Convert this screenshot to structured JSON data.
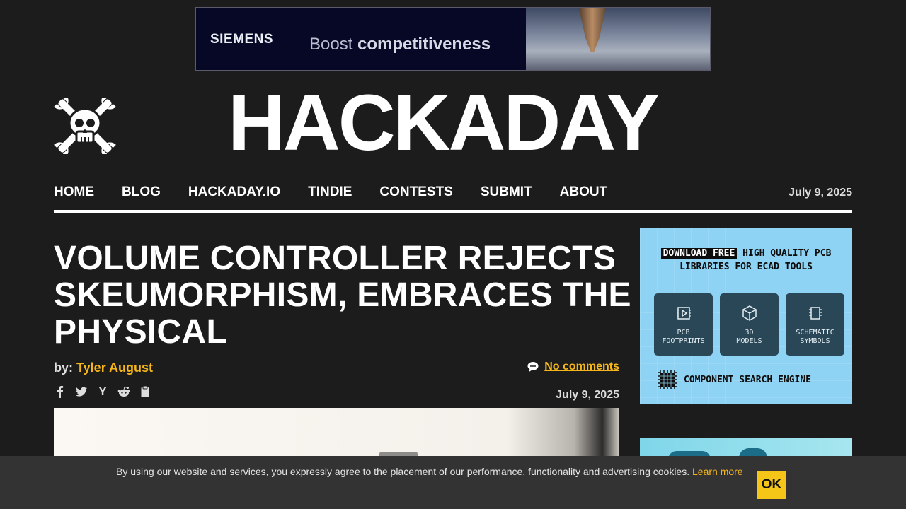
{
  "top_ad": {
    "brand": "SIEMENS",
    "tagline_prefix": "Boost",
    "tagline_emphasis": "competitiveness"
  },
  "site": {
    "title": "HACKADAY",
    "logo_icon": "skull-and-wrenches-icon"
  },
  "nav": {
    "items": [
      {
        "label": "HOME"
      },
      {
        "label": "BLOG"
      },
      {
        "label": "HACKADAY.IO"
      },
      {
        "label": "TINDIE"
      },
      {
        "label": "CONTESTS"
      },
      {
        "label": "SUBMIT"
      },
      {
        "label": "ABOUT"
      }
    ],
    "date": "July 9, 2025"
  },
  "article": {
    "title": "VOLUME CONTROLLER REJECTS SKEUMORPHISM, EMBRACES THE PHYSICAL",
    "byline_prefix": "by:",
    "author": "Tyler August",
    "comments": "No comments",
    "date": "July 9, 2025",
    "share_icons": [
      "facebook-icon",
      "twitter-icon",
      "hacker-news-icon",
      "reddit-icon",
      "clipboard-icon"
    ]
  },
  "sidebar_ad": {
    "highlight": "DOWNLOAD FREE",
    "headline_rest": "HIGH QUALITY PCB",
    "headline_line2": "LIBRARIES FOR ECAD TOOLS",
    "tiles": [
      {
        "line1": "PCB",
        "line2": "FOOTPRINTS",
        "icon": "footprint-icon"
      },
      {
        "line1": "3D",
        "line2": "MODELS",
        "icon": "cube-icon"
      },
      {
        "line1": "SCHEMATIC",
        "line2": "SYMBOLS",
        "icon": "chip-icon"
      }
    ],
    "footer": "COMPONENT SEARCH ENGINE"
  },
  "cookie": {
    "text": "By using our website and services, you expressly agree to the placement of our performance, functionality and advertising cookies.",
    "link": "Learn more",
    "button": "OK"
  },
  "colors": {
    "background": "#1c1c1c",
    "accent": "#f5b61b",
    "ok_button": "#f5c518"
  }
}
